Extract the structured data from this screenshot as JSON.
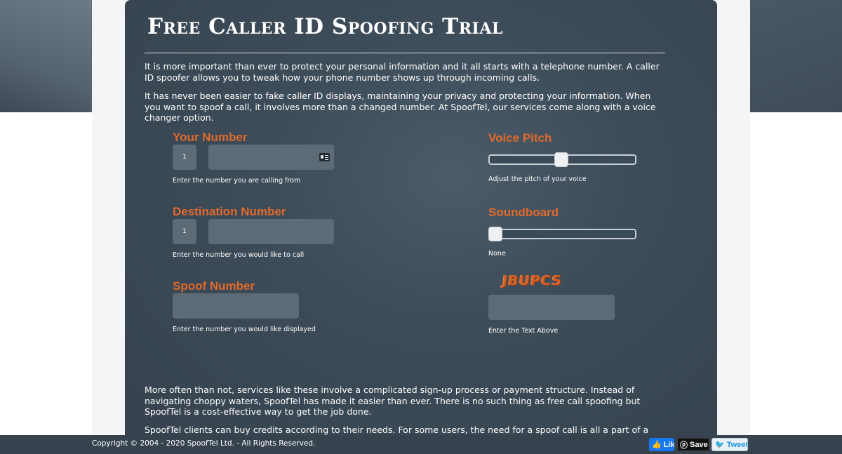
{
  "title": "Free Caller ID Spoofing Trial",
  "intro": {
    "p1": "It is more important than ever to protect your personal information and it all starts with a telephone number. A caller ID spoofer allows you to tweak how your phone number shows up through incoming calls.",
    "p2": "It has never been easier to fake caller ID displays, maintaining your privacy and protecting your information. When you want to spoof a call, it involves more than a changed number. At SpoofTel, our services come along with a voice changer option."
  },
  "form": {
    "your_number": {
      "label": "Your Number",
      "country_code": "1",
      "help": "Enter the number you are calling from"
    },
    "destination_number": {
      "label": "Destination Number",
      "country_code": "1",
      "help": "Enter the number you would like to call"
    },
    "spoof_number": {
      "label": "Spoof Number",
      "help": "Enter the number you would like displayed"
    },
    "voice_pitch": {
      "label": "Voice Pitch",
      "help": "Adjust the pitch of your voice",
      "level": 0.5
    },
    "soundboard": {
      "label": "Soundboard",
      "help": "None",
      "level": 0
    },
    "captcha": {
      "text": "JBUPCS",
      "help": "Enter the Text Above"
    }
  },
  "body": {
    "p3": "More often than not, services like these involve a complicated sign-up process or payment structure. Instead of navigating choppy waters, SpoofTel has made it easier than ever. There is no such thing as free call spoofing but SpoofTel is a cost-effective way to get the job done.",
    "p4": "SpoofTel clients can buy credits according to their needs. For some users, the need for a spoof call is all a part of a daily routine but for"
  },
  "footer": {
    "copyright": "Copyright © 2004 - 2020 SpoofTel Ltd. - All Rights Reserved.",
    "facebook": "Lik",
    "pinterest": "Save",
    "twitter": "Tweet"
  },
  "colors": {
    "accent": "#e06a2c",
    "panel": "#3d4c59",
    "input": "#5d6b76"
  }
}
